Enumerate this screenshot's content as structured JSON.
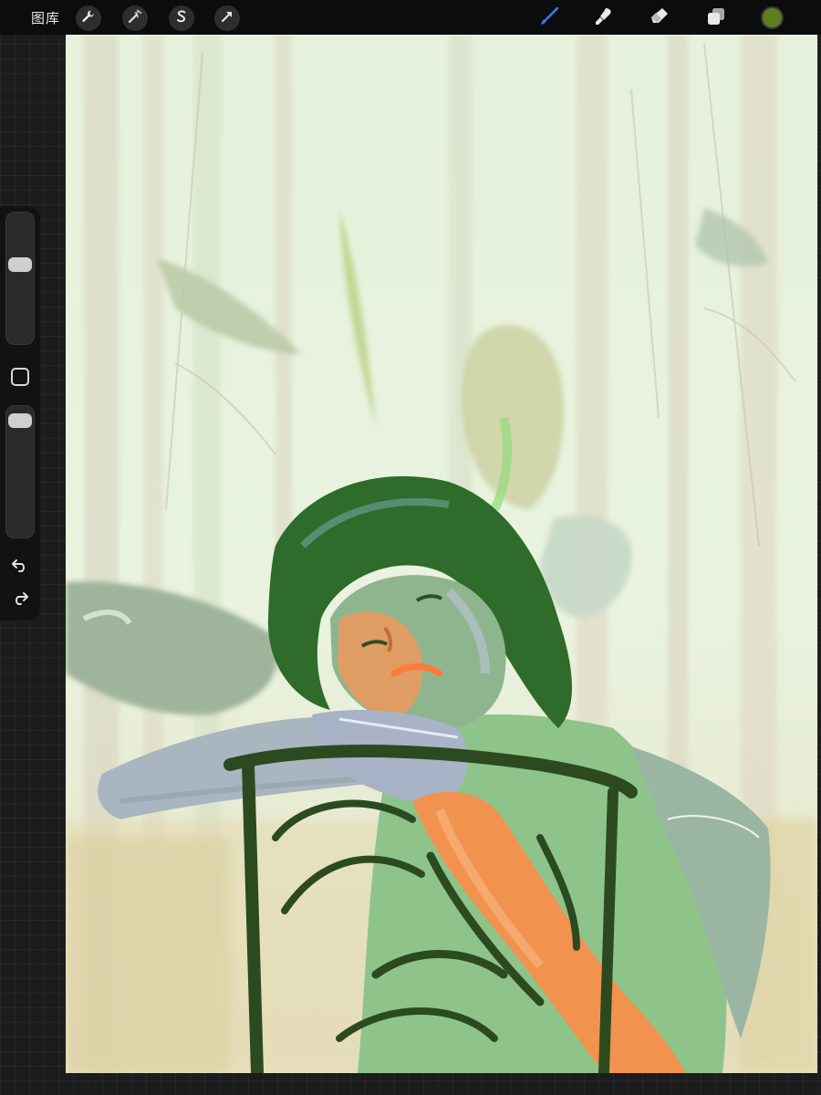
{
  "toolbar": {
    "gallery_label": "图库",
    "left_tools": [
      {
        "name": "wrench-icon",
        "label": "actions"
      },
      {
        "name": "magic-wand-icon",
        "label": "adjustments"
      },
      {
        "name": "selection-icon",
        "label": "selection"
      },
      {
        "name": "transform-arrow-icon",
        "label": "transform"
      }
    ],
    "right_tools": [
      {
        "name": "brush-icon",
        "active": true,
        "color": "#2f7cf6"
      },
      {
        "name": "smudge-icon",
        "active": false
      },
      {
        "name": "eraser-icon",
        "active": false
      },
      {
        "name": "layers-icon",
        "active": false
      }
    ],
    "current_color": "#5e7f1e"
  },
  "sidebar": {
    "brush_size_level": 0.62,
    "opacity_level": 0.95,
    "modify_icon": "square-icon",
    "undo_icon": "undo-icon",
    "redo_icon": "redo-icon"
  },
  "canvas": {
    "palette": {
      "background": "#e4efd9",
      "mint": "#d3e8c6",
      "beige": "#d9cfb5",
      "hair": "#2f6b2a",
      "skin_orange": "#ee9a5a",
      "chair": "#2c4a1f",
      "shirt": "#8fc48a",
      "fish": "#9fb89a"
    }
  }
}
